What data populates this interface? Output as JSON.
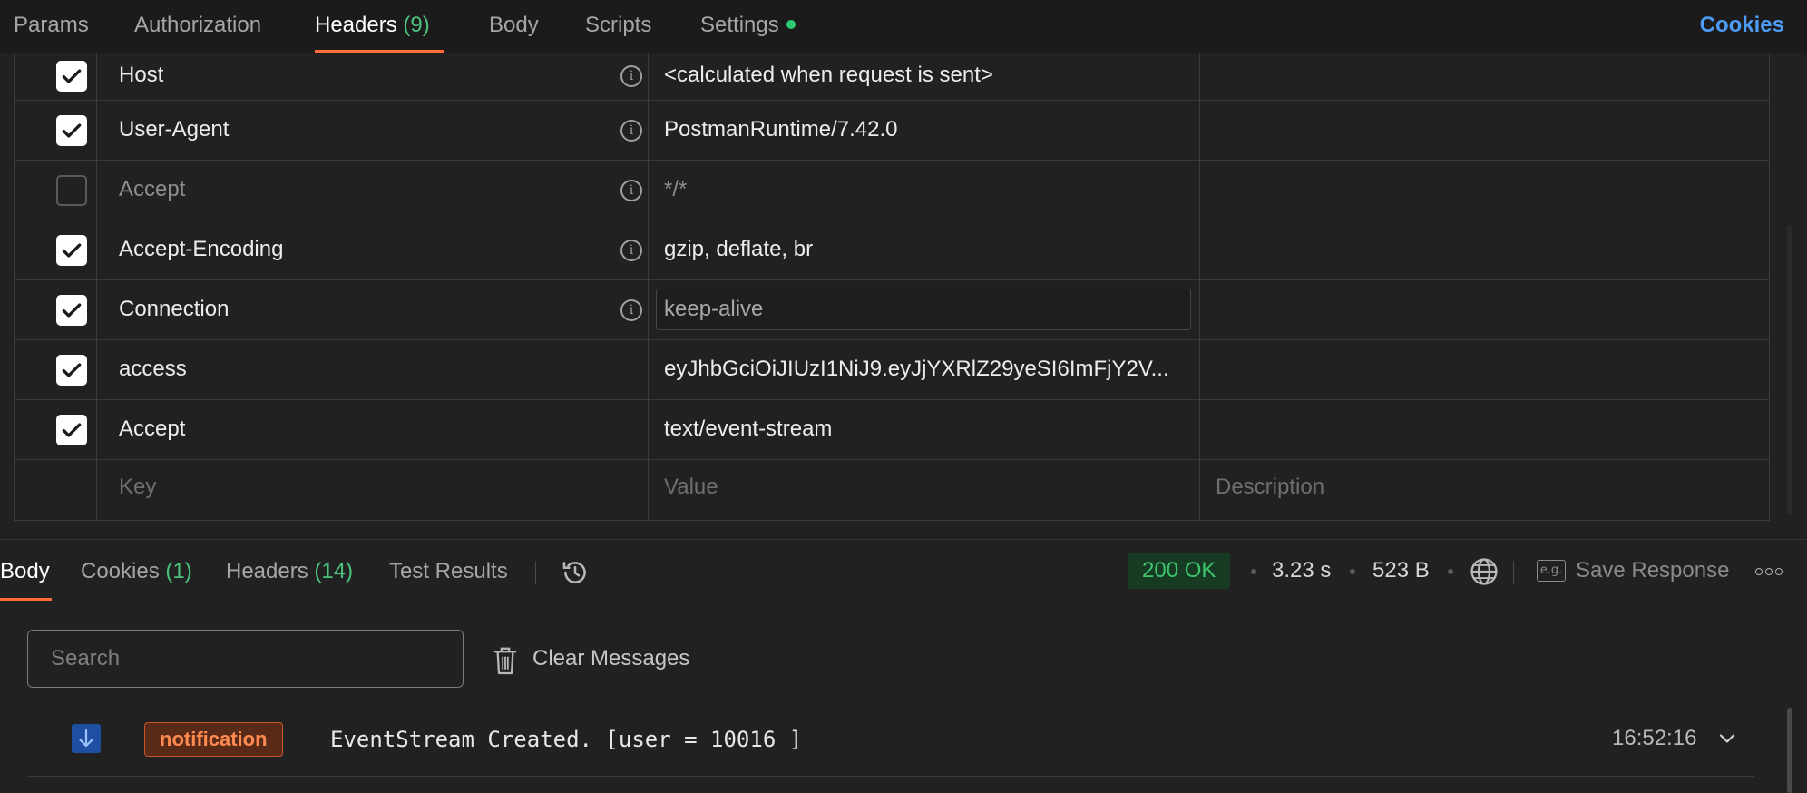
{
  "request_tabs": {
    "params": "Params",
    "authorization": "Authorization",
    "headers": "Headers",
    "headers_count": "(9)",
    "body": "Body",
    "scripts": "Scripts",
    "settings": "Settings",
    "cookies": "Cookies"
  },
  "headers": {
    "rows": [
      {
        "key": "Host",
        "value": "<calculated when request is sent>",
        "checked": true
      },
      {
        "key": "User-Agent",
        "value": "PostmanRuntime/7.42.0",
        "checked": true
      },
      {
        "key": "Accept",
        "value": "*/*",
        "checked": false
      },
      {
        "key": "Accept-Encoding",
        "value": "gzip, deflate, br",
        "checked": true
      },
      {
        "key": "Connection",
        "value": "keep-alive",
        "checked": true
      },
      {
        "key": "access",
        "value": "eyJhbGciOiJIUzI1NiJ9.eyJjYXRlZ29yeSI6ImFjY2V...",
        "checked": true
      },
      {
        "key": "Accept",
        "value": "text/event-stream",
        "checked": true
      }
    ],
    "placeholder_key": "Key",
    "placeholder_value": "Value",
    "placeholder_description": "Description"
  },
  "response": {
    "tabs": {
      "body": "Body",
      "cookies": "Cookies",
      "cookies_count": "(1)",
      "headers": "Headers",
      "headers_count": "(14)",
      "test_results": "Test Results"
    },
    "status": "200 OK",
    "time": "3.23 s",
    "size": "523 B",
    "save_response": "Save Response",
    "eg_label": "e.g."
  },
  "messages": {
    "search_placeholder": "Search",
    "clear_label": "Clear Messages",
    "items": [
      {
        "type": "notification",
        "text": "EventStream Created. [user = 10016 ]",
        "time": "16:52:16"
      }
    ]
  },
  "colors": {
    "accent": "#ff6c37",
    "link": "#4c9bf5",
    "success": "#3ec46d",
    "count": "#4bc27c",
    "notification": "#ff8a50"
  },
  "icons": [
    "info-icon",
    "checkbox-check-icon",
    "history-icon",
    "globe-icon",
    "trash-icon",
    "down-arrow-icon",
    "chevron-down-icon",
    "more-icon"
  ]
}
